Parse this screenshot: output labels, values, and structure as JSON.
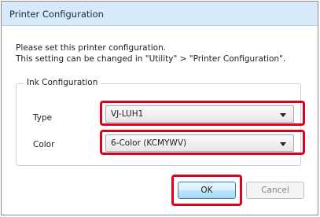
{
  "dialog": {
    "title": "Printer Configuration",
    "message_line1": "Please set this printer configuration.",
    "message_line2": "This setting can be changed in \"Utility\" > \"Printer Configuration\"."
  },
  "ink_configuration": {
    "group_label": "Ink Configuration",
    "type_label": "Type",
    "type_value": "VJ-LUH1",
    "color_label": "Color",
    "color_value": "6-Color (KCMYWV)"
  },
  "buttons": {
    "ok_label": "OK",
    "cancel_label": "Cancel"
  },
  "colors": {
    "highlight": "#e0001b",
    "titlebar": "#d8eaf9"
  },
  "icons": {
    "dropdown": "chevron-down-icon"
  }
}
